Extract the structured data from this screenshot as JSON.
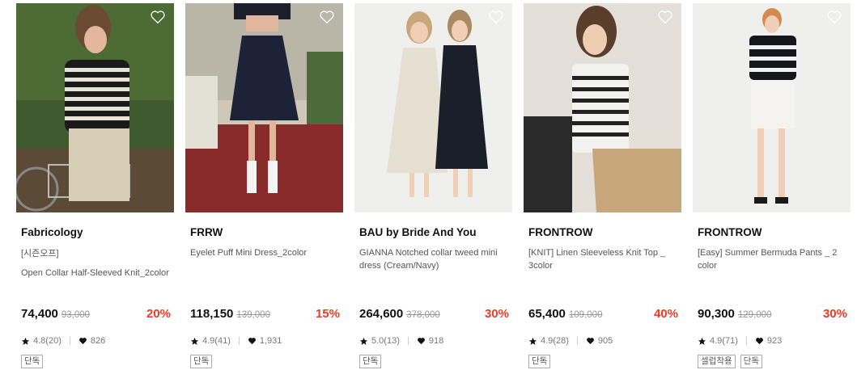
{
  "products": [
    {
      "brand": "Fabricology",
      "sub_label": "[시즌오프]",
      "name": "Open Collar Half-Sleeved Knit_2color",
      "price": "74,400",
      "original_price": "93,000",
      "discount": "20%",
      "rating": "4.8(20)",
      "likes": "826",
      "tags": [
        "단독"
      ]
    },
    {
      "brand": "FRRW",
      "sub_label": "",
      "name": "Eyelet Puff Mini Dress_2color",
      "price": "118,150",
      "original_price": "139,000",
      "discount": "15%",
      "rating": "4.9(41)",
      "likes": "1,931",
      "tags": [
        "단독"
      ]
    },
    {
      "brand": "BAU by Bride And You",
      "sub_label": "",
      "name": "GIANNA Notched collar tweed mini dress (Cream/Navy)",
      "price": "264,600",
      "original_price": "378,000",
      "discount": "30%",
      "rating": "5.0(13)",
      "likes": "918",
      "tags": [
        "단독"
      ]
    },
    {
      "brand": "FRONTROW",
      "sub_label": "",
      "name": "[KNIT] Linen Sleeveless Knit Top _ 3color",
      "price": "65,400",
      "original_price": "109,000",
      "discount": "40%",
      "rating": "4.9(28)",
      "likes": "905",
      "tags": [
        "단독"
      ]
    },
    {
      "brand": "FRONTROW",
      "sub_label": "",
      "name": "[Easy] Summer Bermuda Pants _ 2 color",
      "price": "90,300",
      "original_price": "129,000",
      "discount": "30%",
      "rating": "4.9(71)",
      "likes": "923",
      "tags": [
        "셀럽착용",
        "단독"
      ]
    }
  ],
  "icons": {
    "wishlist": "heart-outline-icon",
    "rating": "star-icon",
    "likes": "heart-filled-icon"
  },
  "colors": {
    "discount": "#ef3a26",
    "price": "#111111",
    "original_price": "#999999"
  }
}
